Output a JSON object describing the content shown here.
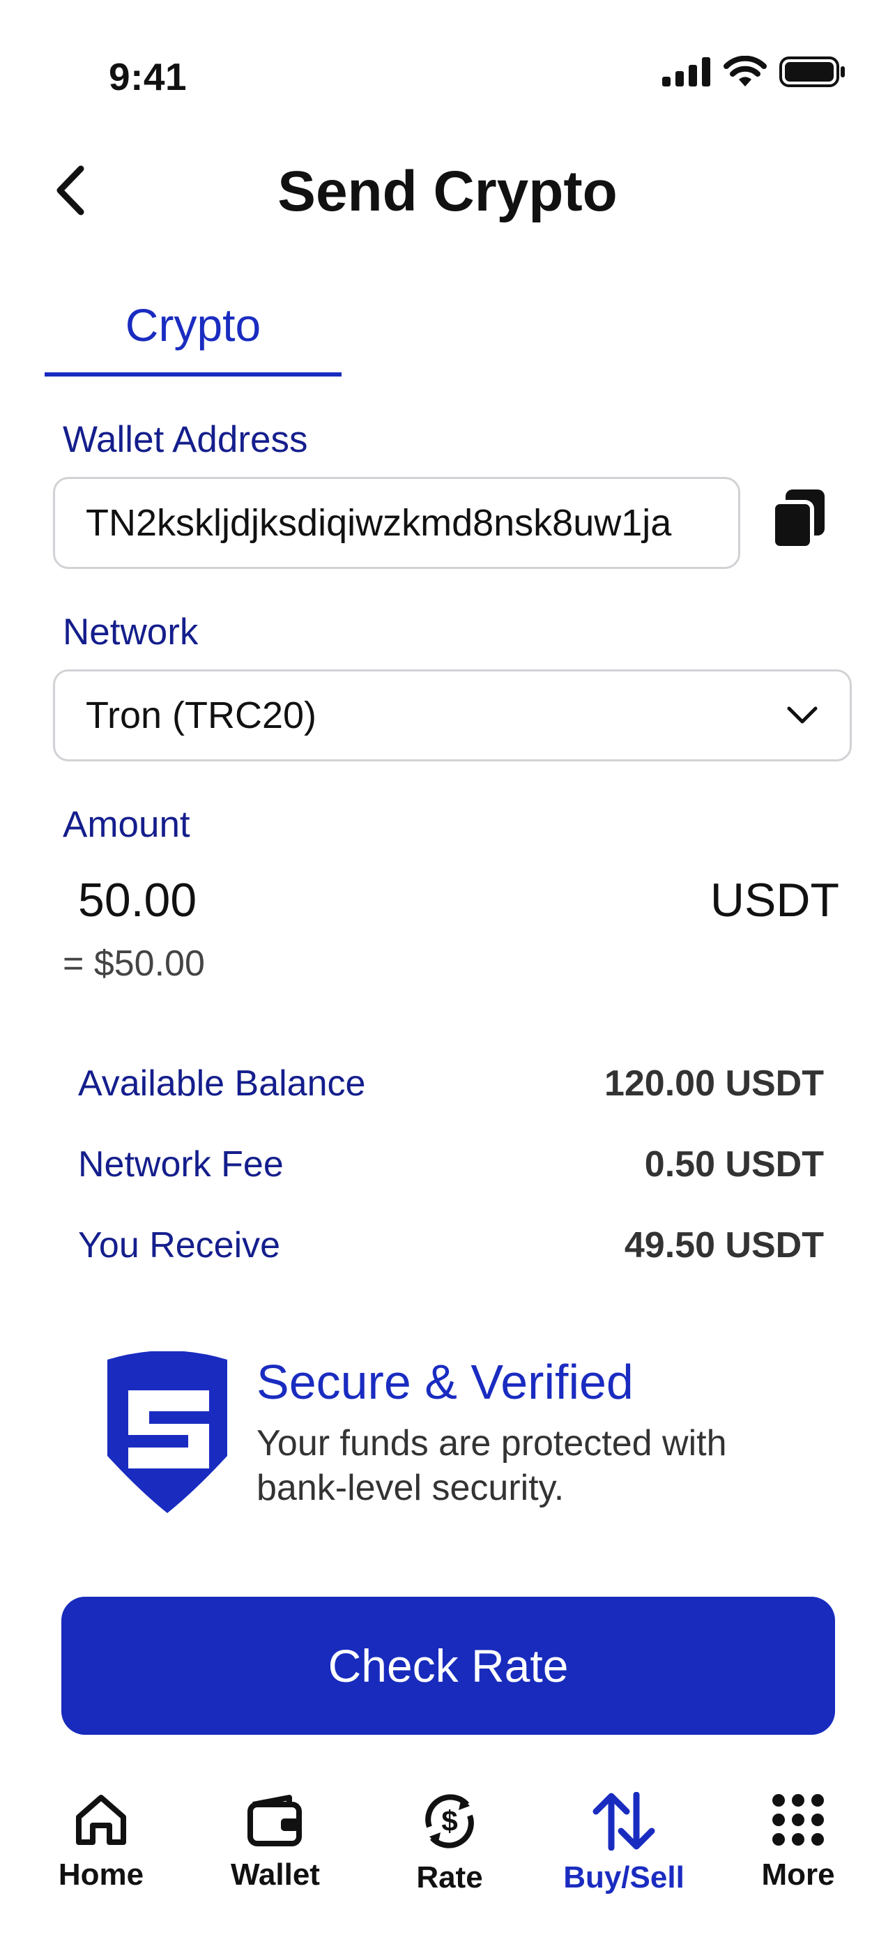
{
  "status_bar": {
    "time": "9:41"
  },
  "header": {
    "title": "Send Crypto"
  },
  "tabs": [
    {
      "label": "Crypto",
      "active": true
    }
  ],
  "wallet": {
    "label": "Wallet Address",
    "value": "TN2kskljdjksdiqiwzkmd8nsk8uw1ja"
  },
  "network": {
    "label": "Network",
    "selected": "Tron (TRC20)"
  },
  "amount": {
    "label": "Amount",
    "value": "50.00",
    "currency": "USDT",
    "usd_equivalent": "= $50.00"
  },
  "summary": [
    {
      "label": "Available Balance",
      "value": "120.00 USDT"
    },
    {
      "label": "Network Fee",
      "value": "0.50 USDT"
    },
    {
      "label": "You Receive",
      "value": "49.50 USDT"
    }
  ],
  "security": {
    "title": "Secure & Verified",
    "text": "Your funds are protected with bank-level security."
  },
  "cta": {
    "label": "Check Rate"
  },
  "bottom_nav": [
    {
      "label": "Home",
      "icon": "home-icon"
    },
    {
      "label": "Wallet",
      "icon": "wallet-icon"
    },
    {
      "label": "Rate",
      "icon": "rate-icon"
    },
    {
      "label": "Buy/Sell",
      "icon": "buy-sell-icon",
      "active": true
    },
    {
      "label": "More",
      "icon": "more-grid-icon"
    }
  ],
  "colors": {
    "accent": "#1a2cc0",
    "label": "#141e8c",
    "button": "#182bbd"
  }
}
